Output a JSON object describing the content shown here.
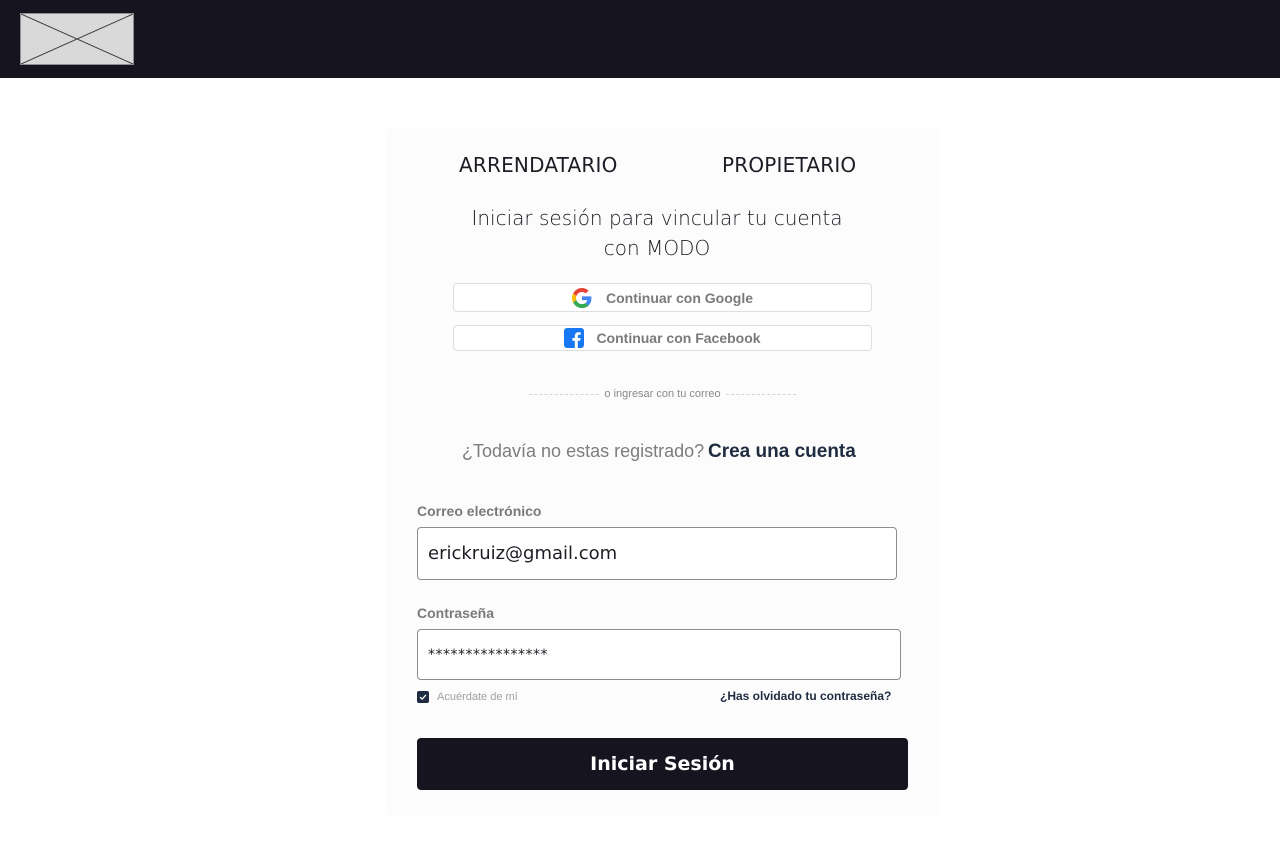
{
  "header": {
    "logo_icon": "image-placeholder-icon",
    "background": "#15141f"
  },
  "tabs": [
    {
      "label": "ARRENDATARIO"
    },
    {
      "label": "PROPIETARIO"
    }
  ],
  "login": {
    "headline_line1": "Iniciar sesión para vincular tu cuenta",
    "headline_line2": "con MODO",
    "google_label": "Continuar con Google",
    "google_icon": "google-icon",
    "facebook_label": "Continuar con Facebook",
    "facebook_icon": "facebook-icon",
    "divider_text": "o ingresar con tu correo",
    "register_question": "¿Todavía no estas registrado?",
    "register_link": "Crea una cuenta",
    "email_label": "Correo electrónico",
    "email_value": "erickruiz@gmail.com",
    "password_label": "Contraseña",
    "password_value": "****************",
    "remember_label": "Acuérdate de mí",
    "remember_checked": true,
    "forgot_link": "¿Has olvidado tu contraseña?",
    "submit_label": "Iniciar Sesión"
  },
  "colors": {
    "dark": "#15141f",
    "accent_text": "#1f2b3f",
    "facebook_blue": "#1877f2"
  }
}
